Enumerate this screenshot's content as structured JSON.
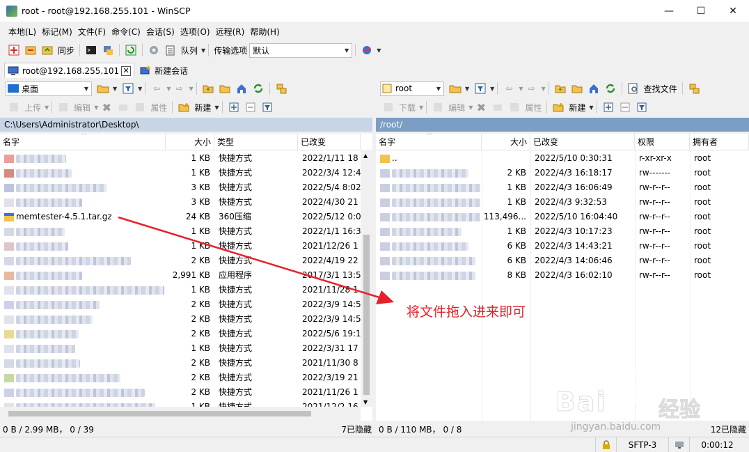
{
  "window": {
    "title": "root - root@192.168.255.101 - WinSCP",
    "min_label": "—",
    "max_label": "☐",
    "close_label": "✕"
  },
  "menu": [
    "本地(L)",
    "标记(M)",
    "文件(F)",
    "命令(C)",
    "会话(S)",
    "选项(O)",
    "远程(R)",
    "帮助(H)"
  ],
  "toolbar": {
    "sync_label": "同步",
    "queue_label": "队列",
    "transfer_label": "传输选项",
    "transfer_value": "默认"
  },
  "tabs": {
    "session_label": "root@192.168.255.101",
    "new_session_label": "新建会话"
  },
  "left": {
    "location": "桌面",
    "upload_label": "上传",
    "edit_label": "编辑",
    "properties_label": "属性",
    "new_label": "新建",
    "path": "C:\\Users\\Administrator\\Desktop\\",
    "columns": {
      "name": "名字",
      "size": "大小",
      "type": "类型",
      "modified": "已改变"
    },
    "rows": [
      {
        "size": "1 KB",
        "type": "快捷方式",
        "modified": "2022/1/11  18"
      },
      {
        "size": "1 KB",
        "type": "快捷方式",
        "modified": "2022/3/4  12:4"
      },
      {
        "size": "3 KB",
        "type": "快捷方式",
        "modified": "2022/5/4  8:02"
      },
      {
        "size": "3 KB",
        "type": "快捷方式",
        "modified": "2022/4/30  21"
      },
      {
        "name": "memtester-4.5.1.tar.gz",
        "size": "24 KB",
        "type": "360压缩",
        "modified": "2022/5/12  0:0"
      },
      {
        "size": "1 KB",
        "type": "快捷方式",
        "modified": "2022/1/1  16:3"
      },
      {
        "size": "1 KB",
        "type": "快捷方式",
        "modified": "2021/12/26  1"
      },
      {
        "size": "2 KB",
        "type": "快捷方式",
        "modified": "2022/4/19  22"
      },
      {
        "size": "2,991 KB",
        "type": "应用程序",
        "modified": "2017/3/1  13:5"
      },
      {
        "size": "1 KB",
        "type": "快捷方式",
        "modified": "2021/11/28  1"
      },
      {
        "size": "2 KB",
        "type": "快捷方式",
        "modified": "2022/3/9  14:5"
      },
      {
        "size": "2 KB",
        "type": "快捷方式",
        "modified": "2022/3/9  14:5"
      },
      {
        "size": "2 KB",
        "type": "快捷方式",
        "modified": "2022/5/6  19:1"
      },
      {
        "size": "1 KB",
        "type": "快捷方式",
        "modified": "2022/3/31  17"
      },
      {
        "size": "2 KB",
        "type": "快捷方式",
        "modified": "2021/11/30  8"
      },
      {
        "size": "2 KB",
        "type": "快捷方式",
        "modified": "2022/3/19  21"
      },
      {
        "size": "2 KB",
        "type": "快捷方式",
        "modified": "2021/11/26  1"
      },
      {
        "size": "1 KB",
        "type": "快捷方式",
        "modified": "2021/12/2  16"
      }
    ],
    "status_left": "0 B / 2.99 MB，  0 / 39",
    "status_right": "7已隐藏"
  },
  "right": {
    "location": "root",
    "download_label": "下载",
    "edit_label": "编辑",
    "properties_label": "属性",
    "new_label": "新建",
    "find_label": "查找文件",
    "path": "/root/",
    "columns": {
      "name": "名字",
      "size": "大小",
      "modified": "已改变",
      "rights": "权限",
      "owner": "拥有者"
    },
    "rows": [
      {
        "name": "..",
        "size": "",
        "modified": "2022/5/10  0:30:31",
        "rights": "r-xr-xr-x",
        "owner": "root"
      },
      {
        "size": "2 KB",
        "modified": "2022/4/3  16:18:17",
        "rights": "rw-------",
        "owner": "root"
      },
      {
        "size": "1 KB",
        "modified": "2022/4/3  16:06:49",
        "rights": "rw-r--r--",
        "owner": "root"
      },
      {
        "size": "1 KB",
        "modified": "2022/4/3  9:32:53",
        "rights": "rw-r--r--",
        "owner": "root"
      },
      {
        "size": "113,496...",
        "modified": "2022/5/10  16:04:40",
        "rights": "rw-r--r--",
        "owner": "root"
      },
      {
        "size": "1 KB",
        "modified": "2022/4/3  10:17:23",
        "rights": "rw-r--r--",
        "owner": "root"
      },
      {
        "size": "6 KB",
        "modified": "2022/4/3  14:43:21",
        "rights": "rw-r--r--",
        "owner": "root"
      },
      {
        "size": "6 KB",
        "modified": "2022/4/3  14:06:46",
        "rights": "rw-r--r--",
        "owner": "root"
      },
      {
        "size": "8 KB",
        "modified": "2022/4/3  16:02:10",
        "rights": "rw-r--r--",
        "owner": "root"
      }
    ],
    "status_left": "0 B / 110 MB，  0 / 8",
    "status_right": "12已隐藏"
  },
  "bottom": {
    "protocol": "SFTP-3",
    "timer": "0:00:12"
  },
  "annotation": "将文件拖入进来即可",
  "watermark": {
    "brand": "Bai",
    "brand_cn": "经验",
    "url": "jingyan.baidu.com"
  },
  "colors": {
    "annotation": "#e8202a",
    "remote_path_bg": "#7a9ec4",
    "local_path_bg": "#c7d5e6"
  }
}
